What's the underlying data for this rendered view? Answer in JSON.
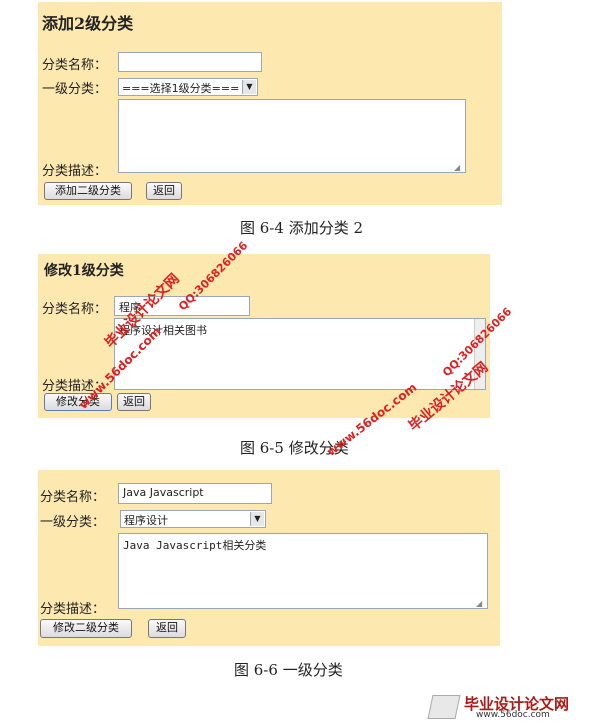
{
  "form1": {
    "title": "添加2级分类",
    "name_label": "分类名称：",
    "name_value": "",
    "level1_label": "一级分类：",
    "level1_selected": "===选择1级分类===",
    "desc_label": "分类描述：",
    "desc_value": "",
    "submit_label": "添加二级分类",
    "back_label": "返回"
  },
  "caption1": "图  6-4  添加分类 2",
  "form2": {
    "title": "修改1级分类",
    "name_label": "分类名称：",
    "name_value": "程序",
    "desc_label": "分类描述：",
    "desc_value": "程序设计相关图书",
    "submit_label": "修改分类",
    "back_label": "返回"
  },
  "caption2": "图  6-5  修改分类",
  "form3": {
    "name_label": "分类名称：",
    "name_value": "Java Javascript",
    "level1_label": "一级分类：",
    "level1_selected": "程序设计",
    "desc_label": "分类描述：",
    "desc_value": "Java Javascript相关分类",
    "submit_label": "修改二级分类",
    "back_label": "返回"
  },
  "caption3": "图  6-6  一级分类",
  "watermarks": {
    "site_cn": "毕业设计论文网",
    "site_url": "www.56doc.com",
    "qq": "QQ:306826066"
  },
  "logo": {
    "text": "毕业设计论文网",
    "url": "www.56doc.com"
  },
  "colors": {
    "panel_bg": "#fde9b0",
    "watermark": "#e02020"
  }
}
